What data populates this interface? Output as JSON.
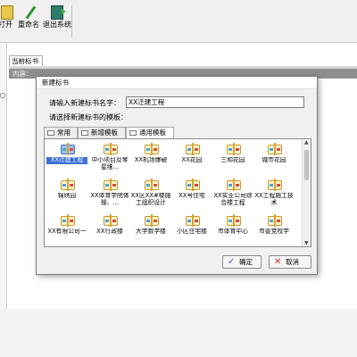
{
  "toolbar": {
    "buttons": [
      {
        "label": "打开",
        "icon": "folder-open-icon"
      },
      {
        "label": "重命名",
        "icon": "pencil-icon"
      },
      {
        "label": "退出系统",
        "icon": "exit-icon"
      }
    ]
  },
  "document": {
    "tab_label": "当前标书",
    "content_label": "内容："
  },
  "dialog": {
    "title": "新建标书",
    "name_label": "请输入新建标书名字：",
    "name_value": "XX迁建工程",
    "template_label": "请选择新建标书的模板：",
    "tabs": [
      {
        "label": "常用",
        "active": false
      },
      {
        "label": "新增模板",
        "active": false
      },
      {
        "label": "通用模板",
        "active": true
      }
    ],
    "templates": [
      {
        "label": "XX迁建工程",
        "selected": true
      },
      {
        "label": "中小项目及零星维...",
        "selected": false
      },
      {
        "label": "XX机场爆破",
        "selected": false
      },
      {
        "label": "XX花园",
        "selected": false
      },
      {
        "label": "三和花园",
        "selected": false
      },
      {
        "label": "城市花园",
        "selected": false
      },
      {
        "label": "锦绣园",
        "selected": false
      },
      {
        "label": "XX体育学院体操、...",
        "selected": false
      },
      {
        "label": "XX区XX#楼施工组织设计",
        "selected": false
      },
      {
        "label": "XX号住宅",
        "selected": false
      },
      {
        "label": "XX实业公司综合楼工程",
        "selected": false
      },
      {
        "label": "XX工程施工技术",
        "selected": false
      },
      {
        "label": "XX有限公司一",
        "selected": false
      },
      {
        "label": "XX行政楼",
        "selected": false
      },
      {
        "label": "大学数学楼",
        "selected": false
      },
      {
        "label": "小区住宅楼",
        "selected": false
      },
      {
        "label": "市体育中心",
        "selected": false
      },
      {
        "label": "市委党校学",
        "selected": false
      }
    ],
    "ok_label": "确定",
    "cancel_label": "取消"
  },
  "colors": {
    "selection": "#3b6fd6",
    "content_header": "#8e8e8e",
    "ok_icon": "#2a5fd0",
    "cancel_icon": "#d42a2a"
  }
}
